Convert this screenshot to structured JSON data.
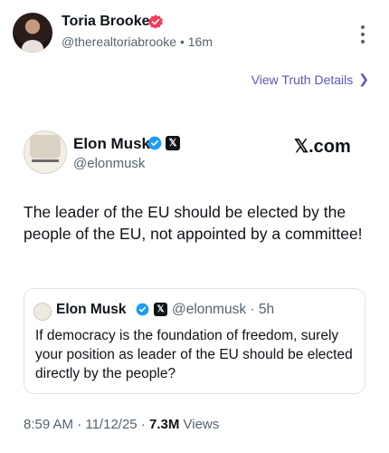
{
  "post": {
    "author_name": "Toria Brooke",
    "handle": "@therealtoriabrooke",
    "separator": "•",
    "time": "16m",
    "view_details": "View Truth Details",
    "chevron": "chevron-right-icon",
    "badge_color": "#f33a5a"
  },
  "embedded": {
    "name": "Elon Musk",
    "handle": "@elonmusk",
    "site": "𝕏.com",
    "text": "The leader of the EU should be elected by the people of the EU, not appointed by a committee!",
    "quoted": {
      "name": "Elon Musk",
      "handle_time": "@elonmusk · 5h",
      "text": "If democracy is the foundation of freedom, surely your position as leader of the EU should be elected directly by the people?"
    },
    "timestamp": "8:59 AM · 11/12/25 · ",
    "views_count": "7.3M",
    "views_label": " Views"
  }
}
